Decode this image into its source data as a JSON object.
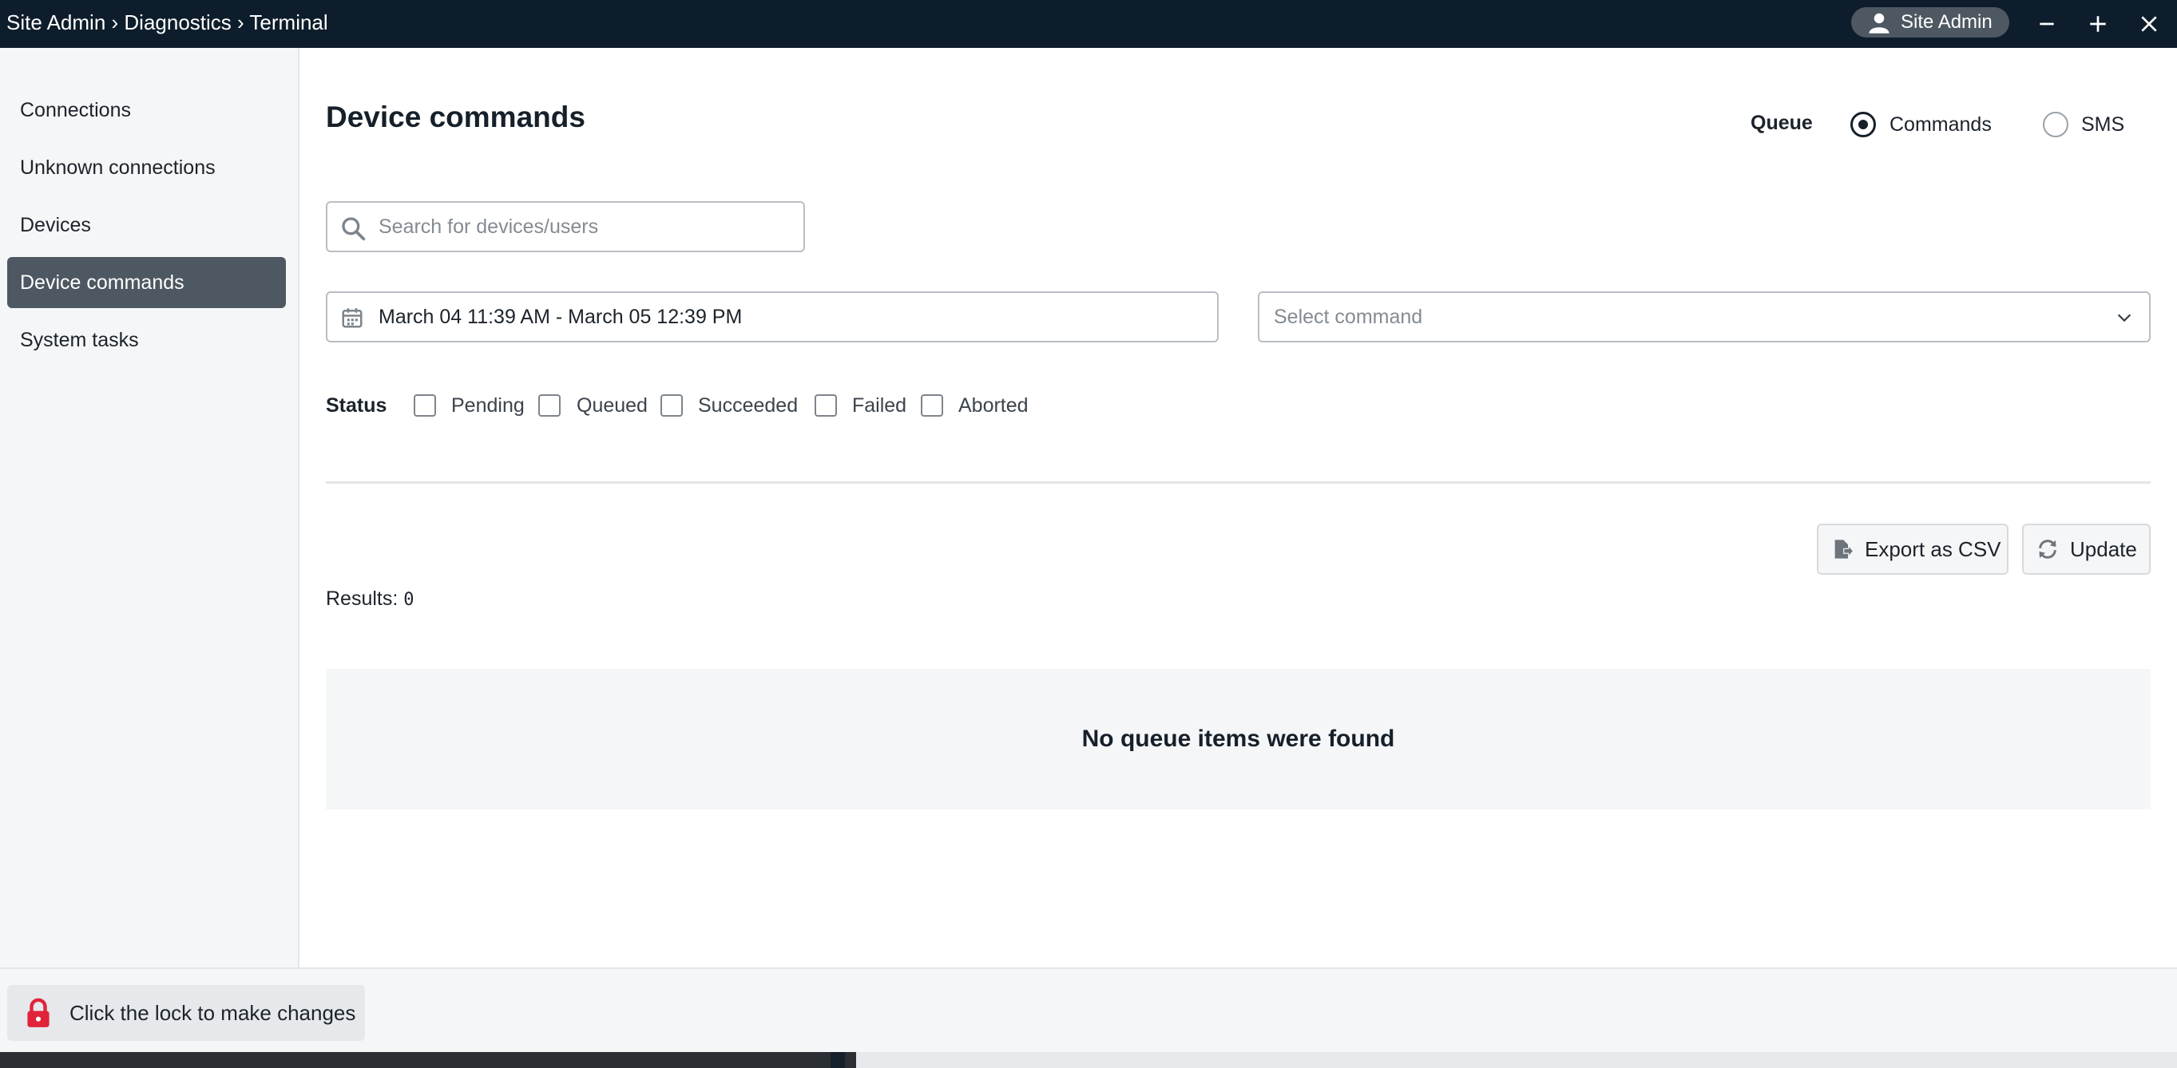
{
  "titlebar": {
    "breadcrumb": "Site Admin › Diagnostics › Terminal",
    "user_label": "Site Admin",
    "icons": [
      "user-icon",
      "minimize-icon",
      "maximize-icon",
      "close-icon"
    ]
  },
  "sidebar": {
    "items": [
      {
        "label": "Connections",
        "active": false
      },
      {
        "label": "Unknown connections",
        "active": false
      },
      {
        "label": "Devices",
        "active": false
      },
      {
        "label": "Device commands",
        "active": true
      },
      {
        "label": "System tasks",
        "active": false
      }
    ]
  },
  "main": {
    "title": "Device commands",
    "queue": {
      "label": "Queue",
      "options": [
        {
          "label": "Commands",
          "selected": true
        },
        {
          "label": "SMS",
          "selected": false
        }
      ]
    },
    "search": {
      "placeholder": "Search for devices/users",
      "value": ""
    },
    "date_range": "March 04 11:39 AM - March 05 12:39 PM",
    "command_select": {
      "placeholder": "Select command"
    },
    "status": {
      "label": "Status",
      "options": [
        {
          "label": "Pending",
          "checked": false
        },
        {
          "label": "Queued",
          "checked": false
        },
        {
          "label": "Succeeded",
          "checked": false
        },
        {
          "label": "Failed",
          "checked": false
        },
        {
          "label": "Aborted",
          "checked": false
        }
      ]
    },
    "results": {
      "label": "Results:",
      "count": "0"
    },
    "actions": {
      "export_label": "Export as CSV",
      "update_label": "Update"
    },
    "empty_message": "No queue items were found"
  },
  "footer": {
    "lock_label": "Click the lock to make changes"
  },
  "colors": {
    "titlebar": "#0e1d2b",
    "active_nav": "#4e5862",
    "lock": "#e0233a",
    "panel": "#f5f6f7"
  }
}
